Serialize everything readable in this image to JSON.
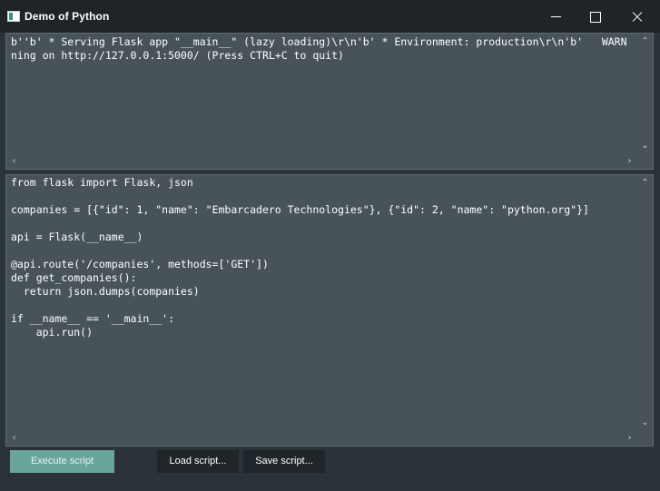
{
  "window": {
    "title": "Demo of Python"
  },
  "output_memo": {
    "lines": [
      "b''b' * Serving Flask app \"__main__\" (lazy loading)\\r\\n'b' * Environment: production\\r\\n'b'   WARN",
      "ning on http://127.0.0.1:5000/ (Press CTRL+C to quit)"
    ]
  },
  "code_memo": {
    "lines": [
      "from flask import Flask, json",
      "",
      "companies = [{\"id\": 1, \"name\": \"Embarcadero Technologies\"}, {\"id\": 2, \"name\": \"python.org\"}]",
      "",
      "api = Flask(__name__)",
      "",
      "@api.route('/companies', methods=['GET'])",
      "def get_companies():",
      "  return json.dumps(companies)",
      "",
      "if __name__ == '__main__':",
      "    api.run()"
    ]
  },
  "buttons": {
    "execute_label": "Execute script",
    "load_label": "Load script...",
    "save_label": "Save script..."
  },
  "icons": {
    "scroll_up": "chevron-up",
    "scroll_down": "chevron-down",
    "scroll_left": "chevron-left",
    "scroll_right": "chevron-right"
  },
  "colors": {
    "background": "#2b3338",
    "memo": "#475359",
    "accent_button": "#6aa59b",
    "button": "#1f2529"
  }
}
